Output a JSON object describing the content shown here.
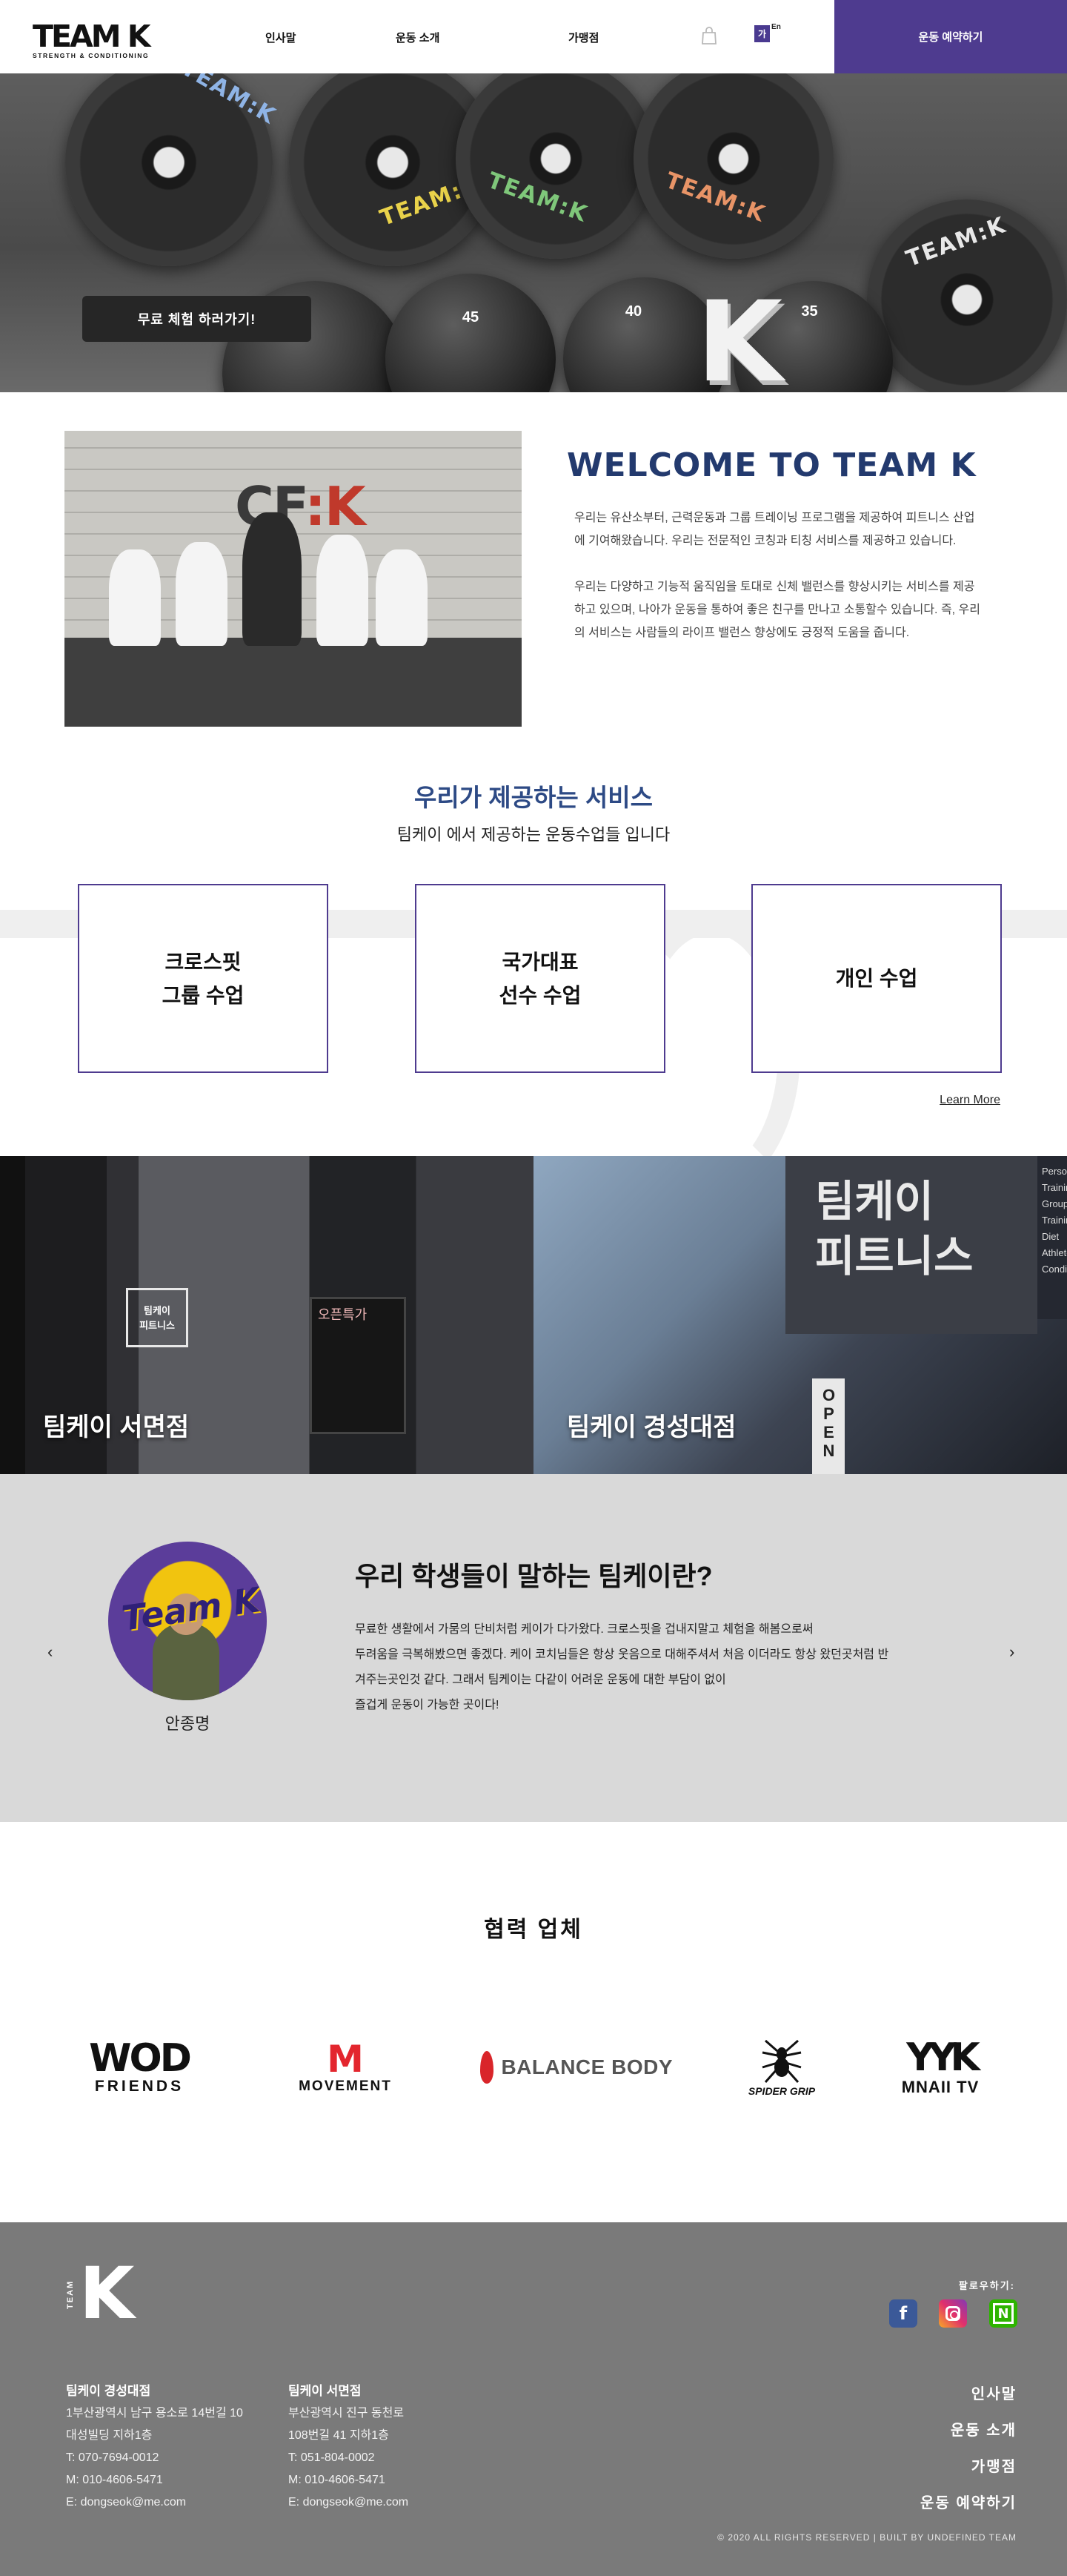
{
  "header": {
    "logo_mark": "TEAM K",
    "logo_tagline": "STRENGTH & CONDITIONING",
    "nav": [
      "인사말",
      "운동 소개",
      "가맹점"
    ],
    "lang_ko": "가",
    "lang_en": "En",
    "reserve_label": "운동 예약하기"
  },
  "hero": {
    "trial_label": "무료 체험 하러가기!",
    "plate_labels": [
      "TEAM:K",
      "TEAM:K",
      "TEAM:K",
      "TEAM:K",
      "TEAM:K"
    ],
    "ball_labels": [
      "45",
      "40",
      "35"
    ],
    "k_letter": "K"
  },
  "welcome": {
    "title": "WELCOME TO TEAM K",
    "para1": "우리는 유산소부터, 근력운동과 그룹 트레이닝 프로그램을 제공하여 피트니스 산업에 기여해왔습니다. 우리는 전문적인 코칭과 티칭 서비스를 제공하고 있습니다.",
    "para2": "우리는 다양하고 기능적 움직임을 토대로 신체 밸런스를 향상시키는 서비스를 제공하고 있으며, 나아가 운동을 통하여 좋은 친구를 만나고 소통할수 있습니다. 즉, 우리의 서비스는 사람들의 라이프 밸런스 향상에도 긍정적 도움을 줍니다.",
    "photo_sign_a": "CF",
    "photo_sign_b": ":K"
  },
  "services": {
    "title": "우리가 제공하는 서비스",
    "subtitle": "팀케이 에서 제공하는 운동수업들 입니다",
    "cards": [
      "크로스핏\n그룹 수업",
      "국가대표\n선수 수업",
      "개인 수업"
    ],
    "learn_more": "Learn More"
  },
  "branches": {
    "items": [
      {
        "label": "팀케이 서면점",
        "sign": "팀케이\n피트니스"
      },
      {
        "label": "팀케이 경성대점",
        "sign": "팀케이\n피트니스"
      }
    ],
    "chalk_title": "오픈특가",
    "side_sign": [
      "Personal",
      "Training",
      "Group",
      "Training",
      "Diet",
      "Athlete",
      "Conditioning"
    ],
    "open_sign": "OPEN"
  },
  "testimonial": {
    "prev": "‹",
    "next": "›",
    "avatar_text": "Team K",
    "name": "안종명",
    "title": "우리 학생들이 말하는 팀케이란?",
    "lines": [
      "무료한 생활에서 가뭄의 단비처럼 케이가 다가왔다. 크로스핏을 겁내지말고 체험을 해봄으로써",
      "두려움을 극복해봤으면 좋겠다. 케이 코치님들은 항상 웃음으로 대해주셔서 처음 이더라도 항상 왔던곳처럼 반",
      "겨주는곳인것 같다. 그래서 팀케이는 다같이 어려운 운동에 대한 부담이 없이",
      "즐겁게 운동이 가능한 곳이다!"
    ]
  },
  "partners": {
    "title": "협력 업체",
    "wod_big": "WOD",
    "wod_small": "FRIENDS",
    "movement_mark": "M",
    "movement_word": "MOVEMENT",
    "balance_word": "BALANCE BODY",
    "spider_icon": "spider-icon",
    "spider_word": "SPIDER GRIP",
    "mnaiitv_mark": "YYK",
    "mnaiitv_word": "MNAII TV"
  },
  "footer": {
    "logo_team": "TEAM",
    "logo_k": "K",
    "follow": "팔로우하기:",
    "facebook": "f",
    "naver": "N",
    "branch1": {
      "name": "팀케이 경성대점",
      "addr1": "1부산광역시 남구 용소로 14번길 10",
      "addr2": "대성빌딩 지하1층",
      "tel": "T: 070-7694-0012",
      "mobile": "M: 010-4606-5471",
      "email": "E: dongseok@me.com"
    },
    "branch2": {
      "name": "팀케이 서면점",
      "addr1": "부산광역시 진구 동천로",
      "addr2": "108번길 41 지하1층",
      "tel": "T: 051-804-0002",
      "mobile": "M: 010-4606-5471",
      "email": "E: dongseok@me.com"
    },
    "nav": [
      "인사말",
      "운동 소개",
      "가맹점",
      "운동 예약하기"
    ],
    "copyright": "© 2020 ALL RIGHTS RESERVED | BUILT BY UNDEFINED TEAM"
  },
  "colors": {
    "accent_purple": "#4e3b8f",
    "title_navy": "#233a6e",
    "service_blue": "#2d4a85",
    "footer_gray": "#7a7a7a",
    "testimonial_gray": "#d9d9d9"
  }
}
